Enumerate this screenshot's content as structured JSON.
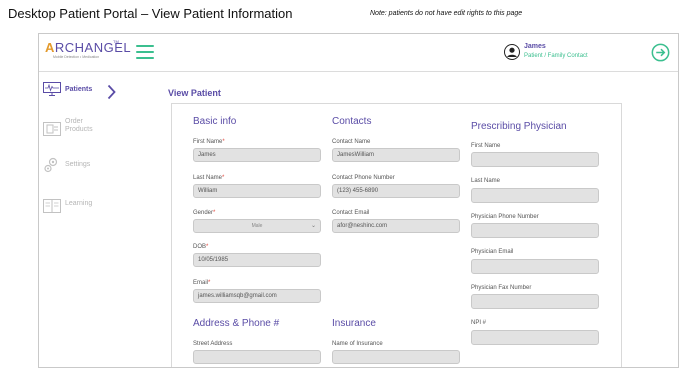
{
  "doc": {
    "title": "Desktop Patient Portal – View Patient Information",
    "note": "Note:  patients do not have edit rights to this page"
  },
  "brand": {
    "logo_text": "ARCHANGEL",
    "logo_tagline": "Mobile Detection • Medication",
    "logo_tm": "TM",
    "primary_color": "#5a4ca6",
    "accent_color": "#3bbf8f"
  },
  "header": {
    "user_name": "James",
    "user_role": "Patient / Family Contact",
    "menu_icon": "hamburger-icon",
    "logout_icon": "arrow-right-circle-icon"
  },
  "sidebar": {
    "items": [
      {
        "label": "Patients",
        "icon": "patients-monitor-icon",
        "active": true
      },
      {
        "label": "Order\nProducts",
        "icon": "order-products-icon",
        "active": false
      },
      {
        "label": "Settings",
        "icon": "gears-icon",
        "active": false
      },
      {
        "label": "Learning",
        "icon": "book-icon",
        "active": false
      }
    ]
  },
  "page": {
    "title": "View Patient"
  },
  "basic_info": {
    "heading": "Basic info",
    "first_name_label": "First Name",
    "first_name": "James",
    "last_name_label": "Last Name",
    "last_name": "William",
    "gender_label": "Gender",
    "gender": "Male",
    "dob_label": "DOB",
    "dob": "10/05/1985",
    "email_label": "Email",
    "email": "james.williamsqb@gmail.com",
    "required_mark": "*"
  },
  "contacts": {
    "heading": "Contacts",
    "contact_name_label": "Contact Name",
    "contact_name": "JamesWilliam",
    "contact_phone_label": "Contact Phone Number",
    "contact_phone": "(123) 455-6890",
    "contact_email_label": "Contact Email",
    "contact_email": "afor@neshinc.com"
  },
  "prescribing": {
    "heading": "Prescribing Physician",
    "first_name_label": "First Name",
    "first_name": "",
    "last_name_label": "Last Name",
    "last_name": "",
    "phone_label": "Physician Phone Number",
    "phone": "",
    "email_label": "Physician Email",
    "email": "",
    "fax_label": "Physician Fax Number",
    "fax": "",
    "npi_label": "NPI #",
    "npi": ""
  },
  "address": {
    "heading": "Address & Phone #",
    "street_label": "Street Address",
    "street": ""
  },
  "insurance": {
    "heading": "Insurance",
    "name_label": "Name of Insurance",
    "name": ""
  }
}
